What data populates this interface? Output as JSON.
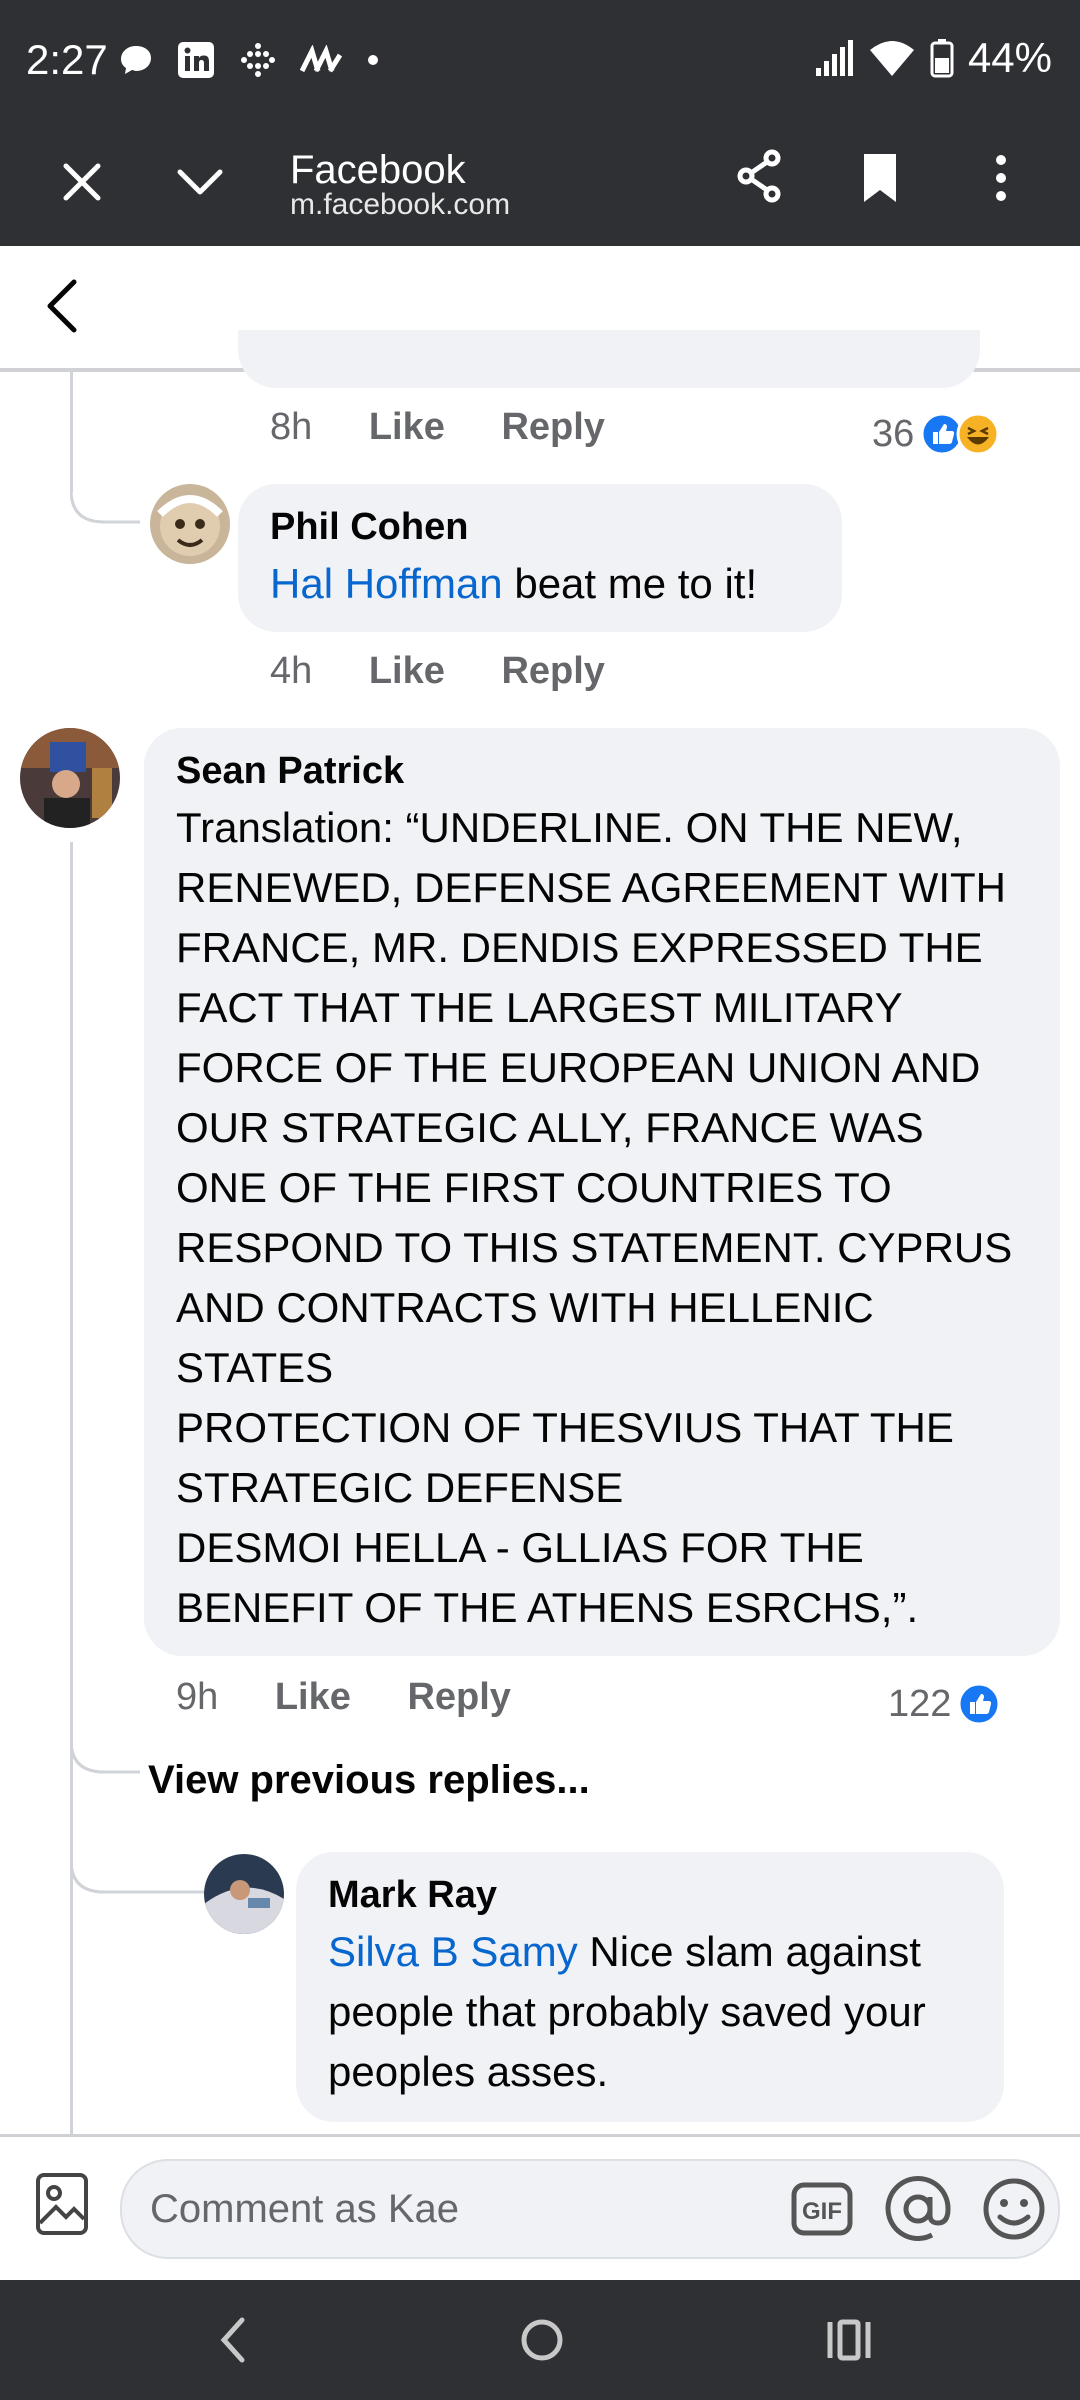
{
  "status_bar": {
    "time": "2:27",
    "battery": "44%"
  },
  "browser": {
    "title": "Facebook",
    "url": "m.facebook.com"
  },
  "comments": [
    {
      "time": "8h",
      "like": "Like",
      "reply": "Reply",
      "reactions": "36"
    },
    {
      "author": "Phil Cohen",
      "mention": "Hal Hoffman",
      "text": " beat me to it!",
      "time": "4h",
      "like": "Like",
      "reply": "Reply"
    },
    {
      "author": "Sean Patrick",
      "lines": [
        "Translation: “UNDERLINE. ON THE NEW,",
        "RENEWED, DEFENSE AGREEMENT WITH",
        "FRANCE, MR. DENDIS EXPRESSED THE",
        "FACT THAT THE LARGEST MILITARY",
        "FORCE OF THE EUROPEAN UNION AND",
        "OUR STRATEGIC ALLY, FRANCE WAS",
        "ONE OF THE FIRST COUNTRIES TO",
        "RESPOND TO THIS STATEMENT. CYPRUS",
        "AND CONTRACTS WITH HELLENIC",
        "STATES",
        "PROTECTION OF THESVIUS THAT THE",
        "STRATEGIC DEFENSE",
        "DESMOI HELLA - GLLIAS FOR THE",
        "BENEFIT OF THE ATHENS ESRCHS,”."
      ],
      "time": "9h",
      "like": "Like",
      "reply": "Reply",
      "reactions": "122"
    },
    {
      "author": "Mark Ray",
      "mention": "Silva B Samy",
      "text_line1": " Nice slam against",
      "text_line2": "people that probably saved your",
      "text_line3": "peoples asses."
    }
  ],
  "view_previous": "View previous replies...",
  "composer": {
    "placeholder": "Comment as Kae"
  },
  "colors": {
    "bar_bg": "#2f3033",
    "bubble_bg": "#f0f2f5",
    "mention": "#0866cf",
    "like_blue": "#1877f2"
  }
}
